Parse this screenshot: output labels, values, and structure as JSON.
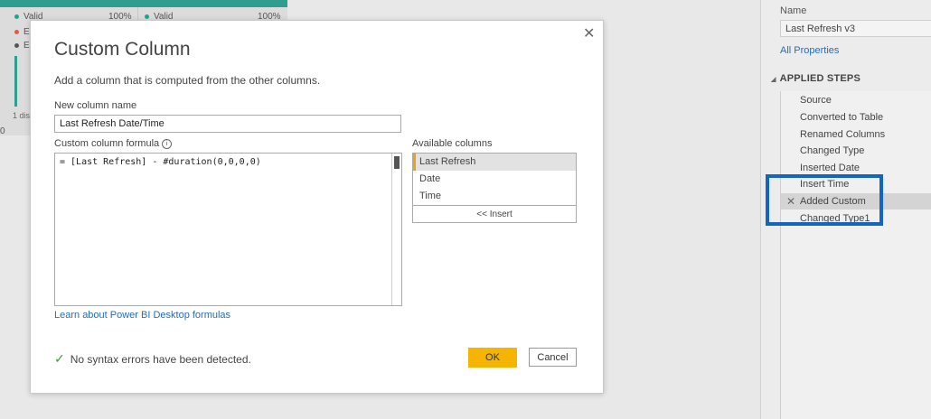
{
  "background": {
    "rows_left": [
      {
        "label": "Valid",
        "pct": "100%",
        "color": "#2f9e8f"
      },
      {
        "label": "E",
        "color": "#e05a4a"
      },
      {
        "label": "E",
        "color": "#555555"
      }
    ],
    "rows_right": [
      {
        "label": "Valid",
        "pct": "100%",
        "color": "#2f9e8f"
      }
    ],
    "distinct_label": "1 dis",
    "zero_label": "0"
  },
  "dialog": {
    "title": "Custom Column",
    "description": "Add a column that is computed from the other columns.",
    "name_label": "New column name",
    "name_value": "Last Refresh Date/Time",
    "formula_label": "Custom column formula",
    "info_glyph": "i",
    "formula_value": "= [Last Refresh] - #duration(0,0,0,0)",
    "learn_link": "Learn about Power BI Desktop formulas",
    "available_label": "Available columns",
    "available_columns": [
      "Last Refresh",
      "Date",
      "Time"
    ],
    "insert_label": "<< Insert",
    "status_text": "No syntax errors have been detected.",
    "ok_label": "OK",
    "cancel_label": "Cancel",
    "close_glyph": "✕",
    "check_glyph": "✓"
  },
  "query_settings": {
    "name_label": "Name",
    "name_value": "Last Refresh v3",
    "all_properties": "All Properties",
    "steps_title": "APPLIED STEPS",
    "steps": [
      "Source",
      "Converted to Table",
      "Renamed Columns",
      "Changed Type",
      "Inserted Date",
      "Insert Time",
      "Added Custom",
      "Changed Type1"
    ],
    "selected_step": "Added Custom",
    "delete_glyph": "✕"
  },
  "colors": {
    "accent": "#f5b400",
    "highlight": "#1565c0",
    "link": "#2b6cb0"
  }
}
